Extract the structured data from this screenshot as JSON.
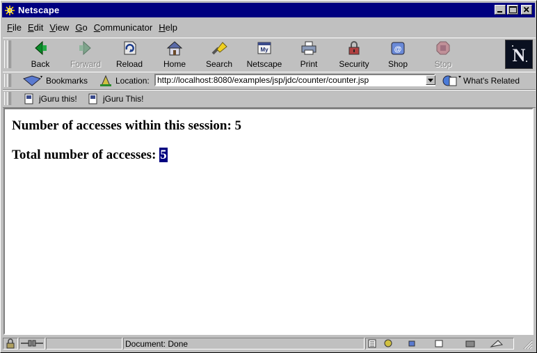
{
  "window": {
    "title": "Netscape"
  },
  "menu": {
    "items": [
      {
        "pre": "",
        "u": "F",
        "post": "ile"
      },
      {
        "pre": "",
        "u": "E",
        "post": "dit"
      },
      {
        "pre": "",
        "u": "V",
        "post": "iew"
      },
      {
        "pre": "",
        "u": "G",
        "post": "o"
      },
      {
        "pre": "",
        "u": "C",
        "post": "ommunicator"
      },
      {
        "pre": "",
        "u": "H",
        "post": "elp"
      }
    ]
  },
  "toolbar": {
    "back": "Back",
    "forward": "Forward",
    "reload": "Reload",
    "home": "Home",
    "search": "Search",
    "netscape": "Netscape",
    "print": "Print",
    "security": "Security",
    "shop": "Shop",
    "stop": "Stop"
  },
  "location": {
    "bookmarks": "Bookmarks",
    "label": "Location:",
    "url": "http://localhost:8080/examples/jsp/jdc/counter/counter.jsp",
    "related": "What's Related"
  },
  "personal": {
    "items": [
      "jGuru this!",
      "jGuru This!"
    ]
  },
  "page": {
    "session_label": "Number of accesses within this session: ",
    "session_count": "5",
    "total_label": "Total number of accesses: ",
    "total_count": "5"
  },
  "status": {
    "text": "Document: Done"
  },
  "colors": {
    "titlebar": "#000080",
    "chrome": "#c0c0c0",
    "selection": "#000080"
  }
}
